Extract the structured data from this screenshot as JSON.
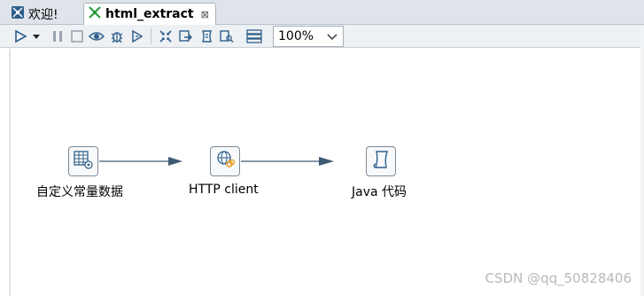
{
  "tabs": [
    {
      "label": "欢迎!",
      "icon": "welcome-icon",
      "active": false
    },
    {
      "label": "html_extract",
      "icon": "job-icon",
      "active": true,
      "close": "⊠"
    }
  ],
  "toolbar": {
    "zoom_value": "100%"
  },
  "flow": {
    "nodes": [
      {
        "label": "自定义常量数据",
        "icon": "fixed-input-icon"
      },
      {
        "label": "HTTP client",
        "icon": "http-client-icon"
      },
      {
        "label": "Java 代码",
        "icon": "java-code-icon"
      }
    ]
  },
  "watermark": "CSDN @qq_50828406",
  "colors": {
    "connector": "#3f5a73",
    "tab_bar": "#dfe4ea",
    "toolbar": "#eef1f4",
    "icon_blue": "#2f5f8a"
  }
}
